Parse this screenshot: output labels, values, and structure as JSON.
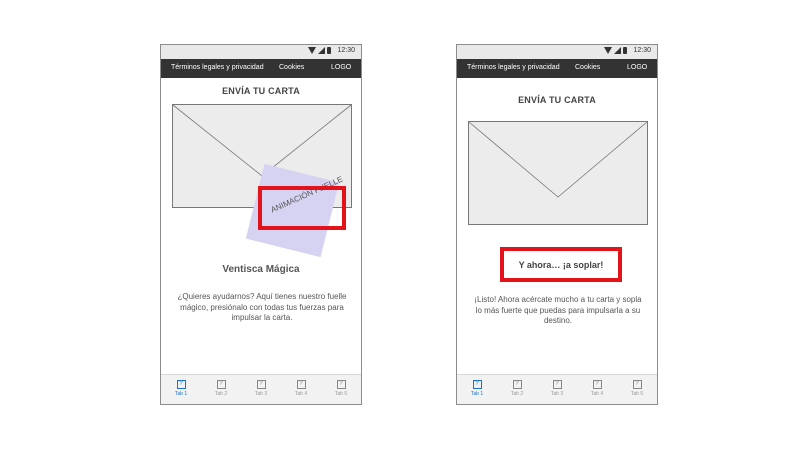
{
  "screens": [
    {
      "status": {
        "time": "12:30"
      },
      "nav": {
        "legal": "Términos legales y privacidad",
        "cookies": "Cookies",
        "logo": "LOGO"
      },
      "title": "ENVÍA TU CARTA",
      "animation_label": "ANIMACIÓN FUELLE",
      "card_title": "Ventisca Mágica",
      "body": "¿Quieres ayudarnos? Aquí tienes nuestro fuelle mágico, presiónalo con todas tus fuerzas para impulsar la carta.",
      "tabs": [
        {
          "icon": "?",
          "label": "Tab 1",
          "active": true
        },
        {
          "icon": "?",
          "label": "Tab 2",
          "active": false
        },
        {
          "icon": "?",
          "label": "Tab 3",
          "active": false
        },
        {
          "icon": "?",
          "label": "Tab 4",
          "active": false
        },
        {
          "icon": "?",
          "label": "Tab 5",
          "active": false
        }
      ]
    },
    {
      "status": {
        "time": "12:30"
      },
      "nav": {
        "legal": "Términos legales y privacidad",
        "cookies": "Cookies",
        "logo": "LOGO"
      },
      "title": "ENVÍA TU CARTA",
      "cta": "Y ahora… ¡a soplar!",
      "body": "¡Listo! Ahora acércate mucho a tu carta y sopla lo más fuerte que puedas para impulsarla a su destino.",
      "tabs": [
        {
          "icon": "?",
          "label": "Tab 1",
          "active": true
        },
        {
          "icon": "?",
          "label": "Tab 2",
          "active": false
        },
        {
          "icon": "?",
          "label": "Tab 3",
          "active": false
        },
        {
          "icon": "?",
          "label": "Tab 4",
          "active": false
        },
        {
          "icon": "?",
          "label": "Tab 5",
          "active": false
        }
      ]
    }
  ],
  "colors": {
    "nav_bg": "#333333",
    "status_bg": "#e9e9e9",
    "highlight": "#e3131b",
    "overlay": "#d6d2f2",
    "tab_active": "#1a73c9"
  }
}
